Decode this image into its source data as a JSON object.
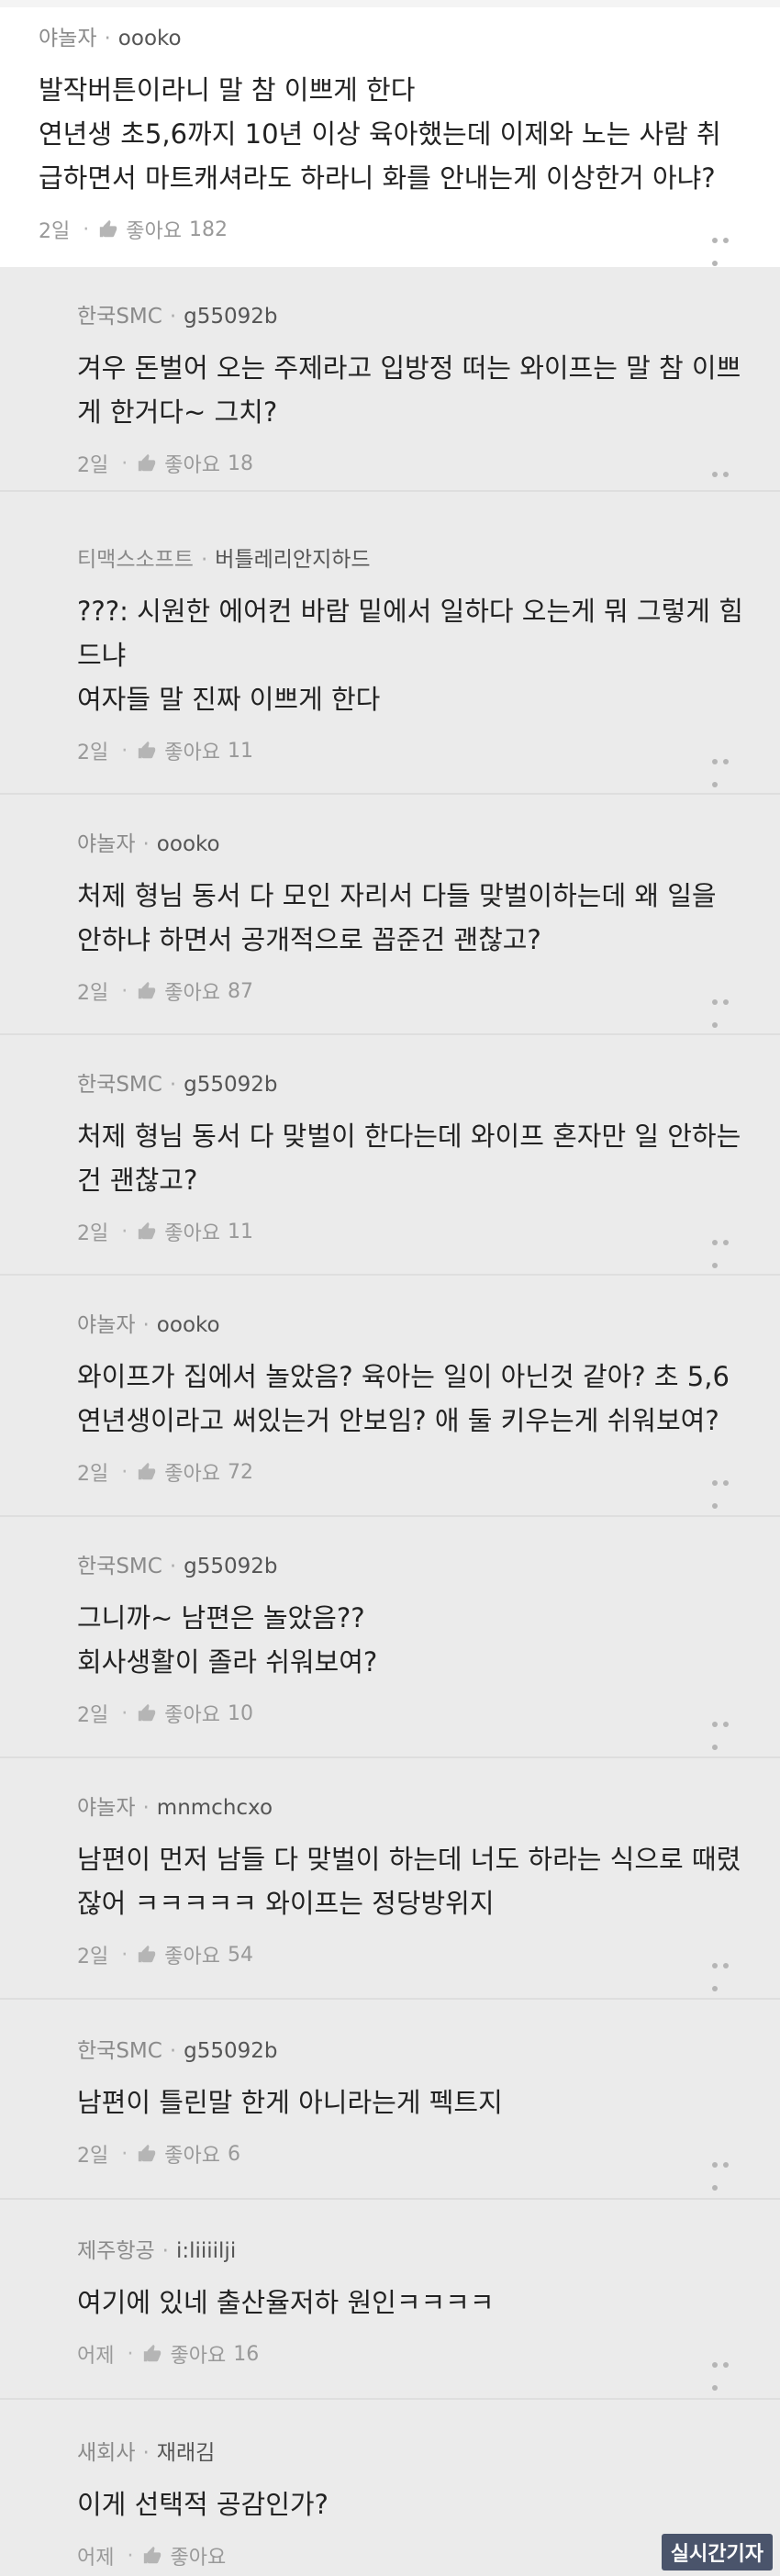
{
  "comments": [
    {
      "company": "야놀자",
      "user": "oooko",
      "body": "발작버튼이라니 말 참 이쁘게 한다\n연년생 초5,6까지 10년 이상 육아했는데 이제와 노는 사람 취급하면서 마트캐셔라도 하라니 화를 안내는게 이상한거 아냐?",
      "time": "2일",
      "like_label": "좋아요",
      "likes": "182"
    },
    {
      "company": "한국SMC",
      "user": "g55092b",
      "body": "겨우 돈벌어 오는 주제라고 입방정 떠는 와이프는 말 참 이쁘게 한거다~ 그치?",
      "time": "2일",
      "like_label": "좋아요",
      "likes": "18"
    },
    {
      "company": "티맥스소프트",
      "user": "버틀레리안지하드",
      "body": "???: 시원한 에어컨 바람 밑에서 일하다 오는게 뭐 그렇게 힘드냐\n여자들 말 진짜 이쁘게 한다",
      "time": "2일",
      "like_label": "좋아요",
      "likes": "11"
    },
    {
      "company": "야놀자",
      "user": "oooko",
      "body": "처제 형님 동서 다 모인 자리서 다들 맞벌이하는데 왜 일을 안하냐 하면서 공개적으로 꼽준건 괜찮고?",
      "time": "2일",
      "like_label": "좋아요",
      "likes": "87"
    },
    {
      "company": "한국SMC",
      "user": "g55092b",
      "body": "처제 형님 동서 다 맞벌이 한다는데 와이프 혼자만 일 안하는건 괜찮고?",
      "time": "2일",
      "like_label": "좋아요",
      "likes": "11"
    },
    {
      "company": "야놀자",
      "user": "oooko",
      "body": "와이프가 집에서 놀았음? 육아는 일이 아닌것 같아? 초 5,6 연년생이라고 써있는거 안보임? 애 둘 키우는게 쉬워보여?",
      "time": "2일",
      "like_label": "좋아요",
      "likes": "72"
    },
    {
      "company": "한국SMC",
      "user": "g55092b",
      "body": "그니까~ 남편은 놀았음??\n회사생활이 졸라 쉬워보여?",
      "time": "2일",
      "like_label": "좋아요",
      "likes": "10"
    },
    {
      "company": "야놀자",
      "user": "mnmchcxo",
      "body": "남편이 먼저 남들 다 맞벌이 하는데 너도 하라는 식으로 때렸잖어 ㅋㅋㅋㅋㅋ 와이프는 정당방위지",
      "time": "2일",
      "like_label": "좋아요",
      "likes": "54"
    },
    {
      "company": "한국SMC",
      "user": "g55092b",
      "body": "남편이 틀린말 한게 아니라는게 펙트지",
      "time": "2일",
      "like_label": "좋아요",
      "likes": "6"
    },
    {
      "company": "제주항공",
      "user": "i:liiiilji",
      "body": "여기에 있네 출산율저하 원인ㅋㅋㅋㅋ",
      "time": "어제",
      "like_label": "좋아요",
      "likes": "16"
    },
    {
      "company": "새회사",
      "user": "재래김",
      "body": "이게 선택적 공감인가?",
      "time": "어제",
      "like_label": "좋아요",
      "likes": ""
    }
  ],
  "icons": {
    "like": "thumbs-up-icon",
    "more": "more-horizontal-icon"
  },
  "watermark": "실시간기자",
  "colors": {
    "top_bg": "#ffffff",
    "reply_bg": "#ebebeb",
    "meta": "#8a8a8a",
    "text": "#222222"
  }
}
